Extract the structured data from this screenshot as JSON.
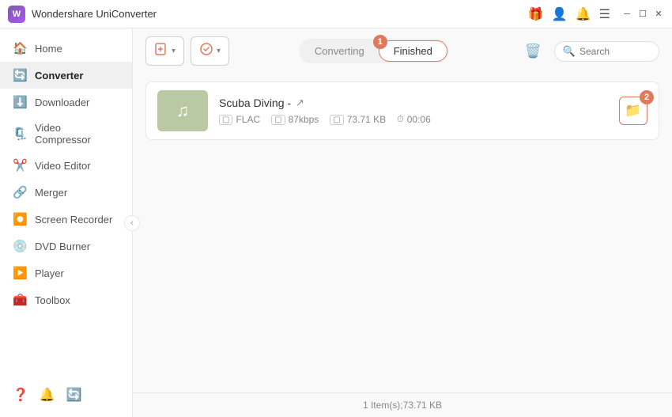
{
  "app": {
    "title": "Wondershare UniConverter",
    "icon": "W"
  },
  "titlebar": {
    "icons": [
      "gift-icon",
      "user-icon",
      "bell-icon",
      "menu-icon"
    ],
    "controls": [
      "minimize-icon",
      "maximize-icon",
      "close-icon"
    ]
  },
  "sidebar": {
    "items": [
      {
        "id": "home",
        "label": "Home",
        "icon": "🏠"
      },
      {
        "id": "converter",
        "label": "Converter",
        "icon": "🔄",
        "active": true
      },
      {
        "id": "downloader",
        "label": "Downloader",
        "icon": "⬇️"
      },
      {
        "id": "video-compressor",
        "label": "Video Compressor",
        "icon": "🗜️"
      },
      {
        "id": "video-editor",
        "label": "Video Editor",
        "icon": "✂️"
      },
      {
        "id": "merger",
        "label": "Merger",
        "icon": "🔗"
      },
      {
        "id": "screen-recorder",
        "label": "Screen Recorder",
        "icon": "⏺️"
      },
      {
        "id": "dvd-burner",
        "label": "DVD Burner",
        "icon": "💿"
      },
      {
        "id": "player",
        "label": "Player",
        "icon": "▶️"
      },
      {
        "id": "toolbox",
        "label": "Toolbox",
        "icon": "🧰"
      }
    ],
    "bottom_icons": [
      "help-icon",
      "bell-icon",
      "sync-icon"
    ]
  },
  "toolbar": {
    "add_button_label": "",
    "add_button_icon": "📄",
    "convert_button_label": "",
    "convert_button_icon": "⚙️",
    "tabs": [
      {
        "id": "converting",
        "label": "Converting"
      },
      {
        "id": "finished",
        "label": "Finished",
        "active": true
      }
    ],
    "tab_badge": "1",
    "tab_badge_2": "2",
    "search_placeholder": "Search",
    "trash_icon": "🗑️"
  },
  "files": [
    {
      "name": "Scuba Diving -",
      "format": "FLAC",
      "bitrate": "87kbps",
      "size": "73.71 KB",
      "duration": "00:06",
      "thumb_icon": "🎵",
      "open_icon": "↗"
    }
  ],
  "status": {
    "text": "1 Item(s);73.71 KB"
  }
}
